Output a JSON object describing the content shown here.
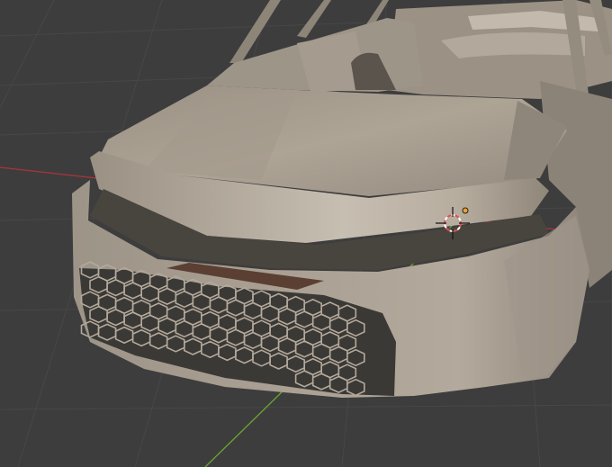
{
  "viewport": {
    "background": "#3d3d3d",
    "grid_color": "#474747",
    "x_axis_color": "#a8343c",
    "y_axis_color": "#6aa534"
  },
  "model": {
    "body_color": "#a79d90",
    "body_shadow": "#6f665c",
    "body_highlight": "#c8bfb3",
    "grille": "hexagon-mesh"
  },
  "cursor": {
    "icon": "3d-cursor-icon",
    "ring_color": "#e05050"
  },
  "origin_marker_color": "#f0a030"
}
